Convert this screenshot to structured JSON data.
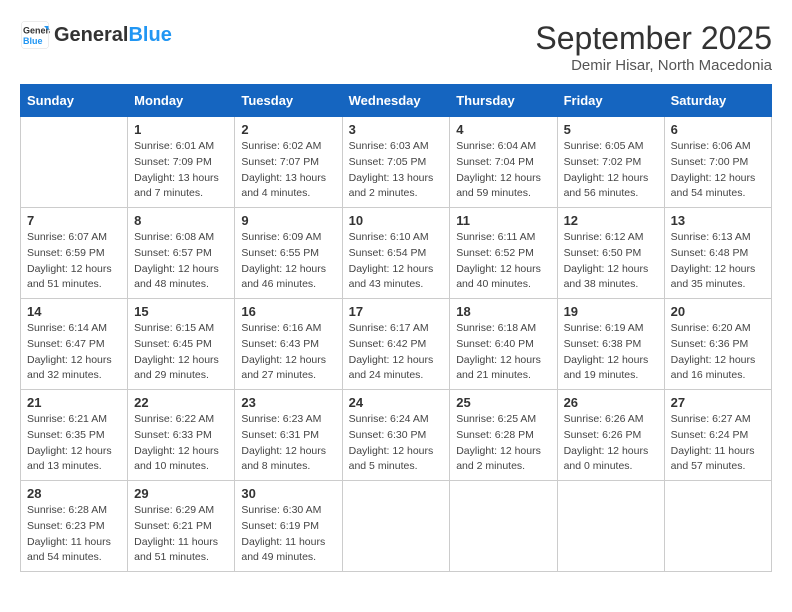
{
  "header": {
    "logo_general": "General",
    "logo_blue": "Blue",
    "month_title": "September 2025",
    "subtitle": "Demir Hisar, North Macedonia"
  },
  "days_of_week": [
    "Sunday",
    "Monday",
    "Tuesday",
    "Wednesday",
    "Thursday",
    "Friday",
    "Saturday"
  ],
  "weeks": [
    [
      {
        "day": "",
        "info": ""
      },
      {
        "day": "1",
        "info": "Sunrise: 6:01 AM\nSunset: 7:09 PM\nDaylight: 13 hours\nand 7 minutes."
      },
      {
        "day": "2",
        "info": "Sunrise: 6:02 AM\nSunset: 7:07 PM\nDaylight: 13 hours\nand 4 minutes."
      },
      {
        "day": "3",
        "info": "Sunrise: 6:03 AM\nSunset: 7:05 PM\nDaylight: 13 hours\nand 2 minutes."
      },
      {
        "day": "4",
        "info": "Sunrise: 6:04 AM\nSunset: 7:04 PM\nDaylight: 12 hours\nand 59 minutes."
      },
      {
        "day": "5",
        "info": "Sunrise: 6:05 AM\nSunset: 7:02 PM\nDaylight: 12 hours\nand 56 minutes."
      },
      {
        "day": "6",
        "info": "Sunrise: 6:06 AM\nSunset: 7:00 PM\nDaylight: 12 hours\nand 54 minutes."
      }
    ],
    [
      {
        "day": "7",
        "info": "Sunrise: 6:07 AM\nSunset: 6:59 PM\nDaylight: 12 hours\nand 51 minutes."
      },
      {
        "day": "8",
        "info": "Sunrise: 6:08 AM\nSunset: 6:57 PM\nDaylight: 12 hours\nand 48 minutes."
      },
      {
        "day": "9",
        "info": "Sunrise: 6:09 AM\nSunset: 6:55 PM\nDaylight: 12 hours\nand 46 minutes."
      },
      {
        "day": "10",
        "info": "Sunrise: 6:10 AM\nSunset: 6:54 PM\nDaylight: 12 hours\nand 43 minutes."
      },
      {
        "day": "11",
        "info": "Sunrise: 6:11 AM\nSunset: 6:52 PM\nDaylight: 12 hours\nand 40 minutes."
      },
      {
        "day": "12",
        "info": "Sunrise: 6:12 AM\nSunset: 6:50 PM\nDaylight: 12 hours\nand 38 minutes."
      },
      {
        "day": "13",
        "info": "Sunrise: 6:13 AM\nSunset: 6:48 PM\nDaylight: 12 hours\nand 35 minutes."
      }
    ],
    [
      {
        "day": "14",
        "info": "Sunrise: 6:14 AM\nSunset: 6:47 PM\nDaylight: 12 hours\nand 32 minutes."
      },
      {
        "day": "15",
        "info": "Sunrise: 6:15 AM\nSunset: 6:45 PM\nDaylight: 12 hours\nand 29 minutes."
      },
      {
        "day": "16",
        "info": "Sunrise: 6:16 AM\nSunset: 6:43 PM\nDaylight: 12 hours\nand 27 minutes."
      },
      {
        "day": "17",
        "info": "Sunrise: 6:17 AM\nSunset: 6:42 PM\nDaylight: 12 hours\nand 24 minutes."
      },
      {
        "day": "18",
        "info": "Sunrise: 6:18 AM\nSunset: 6:40 PM\nDaylight: 12 hours\nand 21 minutes."
      },
      {
        "day": "19",
        "info": "Sunrise: 6:19 AM\nSunset: 6:38 PM\nDaylight: 12 hours\nand 19 minutes."
      },
      {
        "day": "20",
        "info": "Sunrise: 6:20 AM\nSunset: 6:36 PM\nDaylight: 12 hours\nand 16 minutes."
      }
    ],
    [
      {
        "day": "21",
        "info": "Sunrise: 6:21 AM\nSunset: 6:35 PM\nDaylight: 12 hours\nand 13 minutes."
      },
      {
        "day": "22",
        "info": "Sunrise: 6:22 AM\nSunset: 6:33 PM\nDaylight: 12 hours\nand 10 minutes."
      },
      {
        "day": "23",
        "info": "Sunrise: 6:23 AM\nSunset: 6:31 PM\nDaylight: 12 hours\nand 8 minutes."
      },
      {
        "day": "24",
        "info": "Sunrise: 6:24 AM\nSunset: 6:30 PM\nDaylight: 12 hours\nand 5 minutes."
      },
      {
        "day": "25",
        "info": "Sunrise: 6:25 AM\nSunset: 6:28 PM\nDaylight: 12 hours\nand 2 minutes."
      },
      {
        "day": "26",
        "info": "Sunrise: 6:26 AM\nSunset: 6:26 PM\nDaylight: 12 hours\nand 0 minutes."
      },
      {
        "day": "27",
        "info": "Sunrise: 6:27 AM\nSunset: 6:24 PM\nDaylight: 11 hours\nand 57 minutes."
      }
    ],
    [
      {
        "day": "28",
        "info": "Sunrise: 6:28 AM\nSunset: 6:23 PM\nDaylight: 11 hours\nand 54 minutes."
      },
      {
        "day": "29",
        "info": "Sunrise: 6:29 AM\nSunset: 6:21 PM\nDaylight: 11 hours\nand 51 minutes."
      },
      {
        "day": "30",
        "info": "Sunrise: 6:30 AM\nSunset: 6:19 PM\nDaylight: 11 hours\nand 49 minutes."
      },
      {
        "day": "",
        "info": ""
      },
      {
        "day": "",
        "info": ""
      },
      {
        "day": "",
        "info": ""
      },
      {
        "day": "",
        "info": ""
      }
    ]
  ]
}
